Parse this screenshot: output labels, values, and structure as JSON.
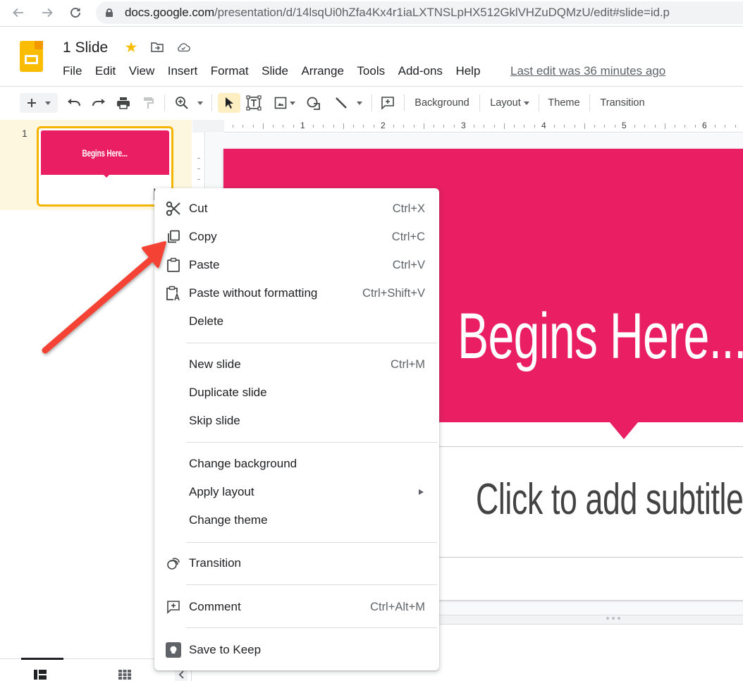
{
  "browser": {
    "url_host": "docs.google.com",
    "url_path": "/presentation/d/14lsqUi0hZfa4Kx4r1iaLXTNSLpHX512GklVHZuDQMzU/edit#slide=id.p"
  },
  "header": {
    "doc_title": "1 Slide",
    "menus": [
      "File",
      "Edit",
      "View",
      "Insert",
      "Format",
      "Slide",
      "Arrange",
      "Tools",
      "Add-ons",
      "Help"
    ],
    "last_edit": "Last edit was 36 minutes ago"
  },
  "toolbar": {
    "background_label": "Background",
    "layout_label": "Layout",
    "theme_label": "Theme",
    "transition_label": "Transition"
  },
  "ruler": {
    "labels": [
      "1",
      "2",
      "3",
      "4",
      "5",
      "6"
    ]
  },
  "filmstrip": {
    "slides": [
      {
        "number": "1",
        "title": "Begins Here..."
      }
    ]
  },
  "slide": {
    "title": "Begins Here...",
    "subtitle_placeholder": "Click to add subtitle",
    "accent_color": "#e91e63"
  },
  "context_menu": {
    "items": [
      {
        "label": "Cut",
        "shortcut": "Ctrl+X",
        "icon": "scissors-icon"
      },
      {
        "label": "Copy",
        "shortcut": "Ctrl+C",
        "icon": "copy-icon"
      },
      {
        "label": "Paste",
        "shortcut": "Ctrl+V",
        "icon": "clipboard-icon"
      },
      {
        "label": "Paste without formatting",
        "shortcut": "Ctrl+Shift+V",
        "icon": "paste-plain-icon"
      },
      {
        "label": "Delete",
        "shortcut": "",
        "icon": ""
      },
      {
        "label": "New slide",
        "shortcut": "Ctrl+M",
        "icon": ""
      },
      {
        "label": "Duplicate slide",
        "shortcut": "",
        "icon": ""
      },
      {
        "label": "Skip slide",
        "shortcut": "",
        "icon": ""
      },
      {
        "label": "Change background",
        "shortcut": "",
        "icon": ""
      },
      {
        "label": "Apply layout",
        "shortcut": "",
        "icon": "",
        "submenu": true
      },
      {
        "label": "Change theme",
        "shortcut": "",
        "icon": ""
      },
      {
        "label": "Transition",
        "shortcut": "",
        "icon": "transition-icon"
      },
      {
        "label": "Comment",
        "shortcut": "Ctrl+Alt+M",
        "icon": "add-comment-icon"
      },
      {
        "label": "Save to Keep",
        "shortcut": "",
        "icon": "keep-icon"
      }
    ]
  },
  "annotation": {
    "color": "#f44336",
    "points_to": "Copy"
  }
}
